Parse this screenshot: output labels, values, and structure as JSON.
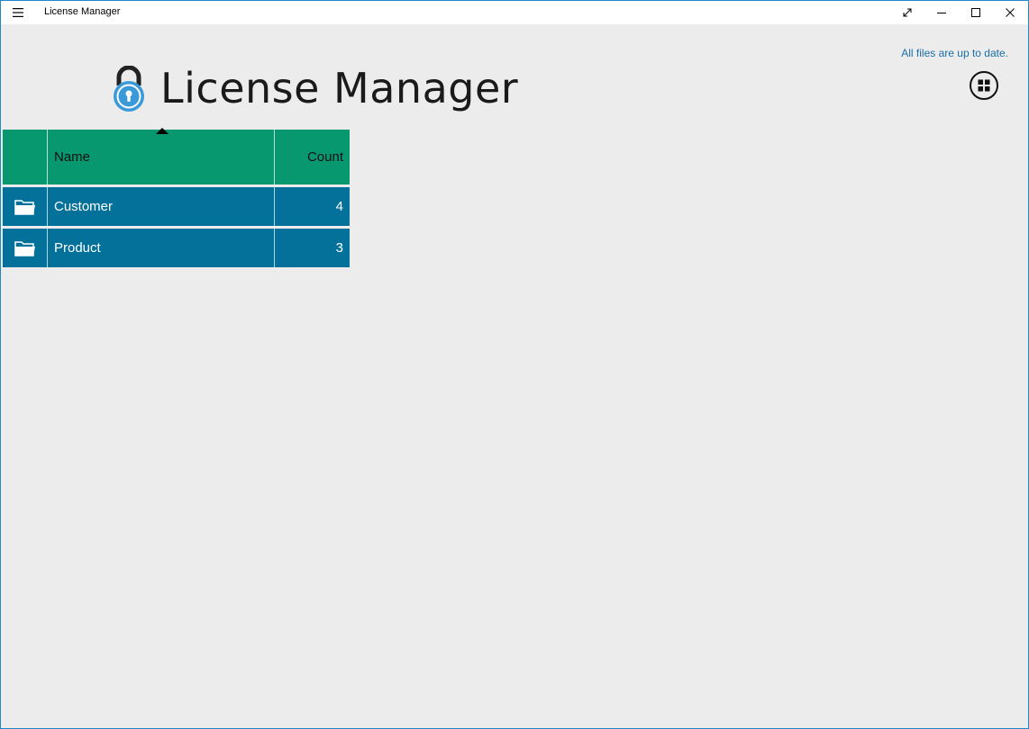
{
  "window": {
    "title": "License Manager"
  },
  "header": {
    "title": "License Manager",
    "status": "All files are up to date.",
    "logo_icon": "padlock-icon",
    "layout_toggle_icon": "grid-view-icon"
  },
  "table": {
    "columns": {
      "name": "Name",
      "count": "Count"
    },
    "sort": "Name ascending",
    "rows": [
      {
        "icon": "folder-icon",
        "name": "Customer",
        "count": "4"
      },
      {
        "icon": "folder-icon",
        "name": "Product",
        "count": "3"
      }
    ]
  },
  "colors": {
    "header_green": "#079870",
    "row_blue": "#03719a",
    "status_blue": "#1a6fa8",
    "logo_blue": "#3a9ad9",
    "background": "#ececec"
  }
}
